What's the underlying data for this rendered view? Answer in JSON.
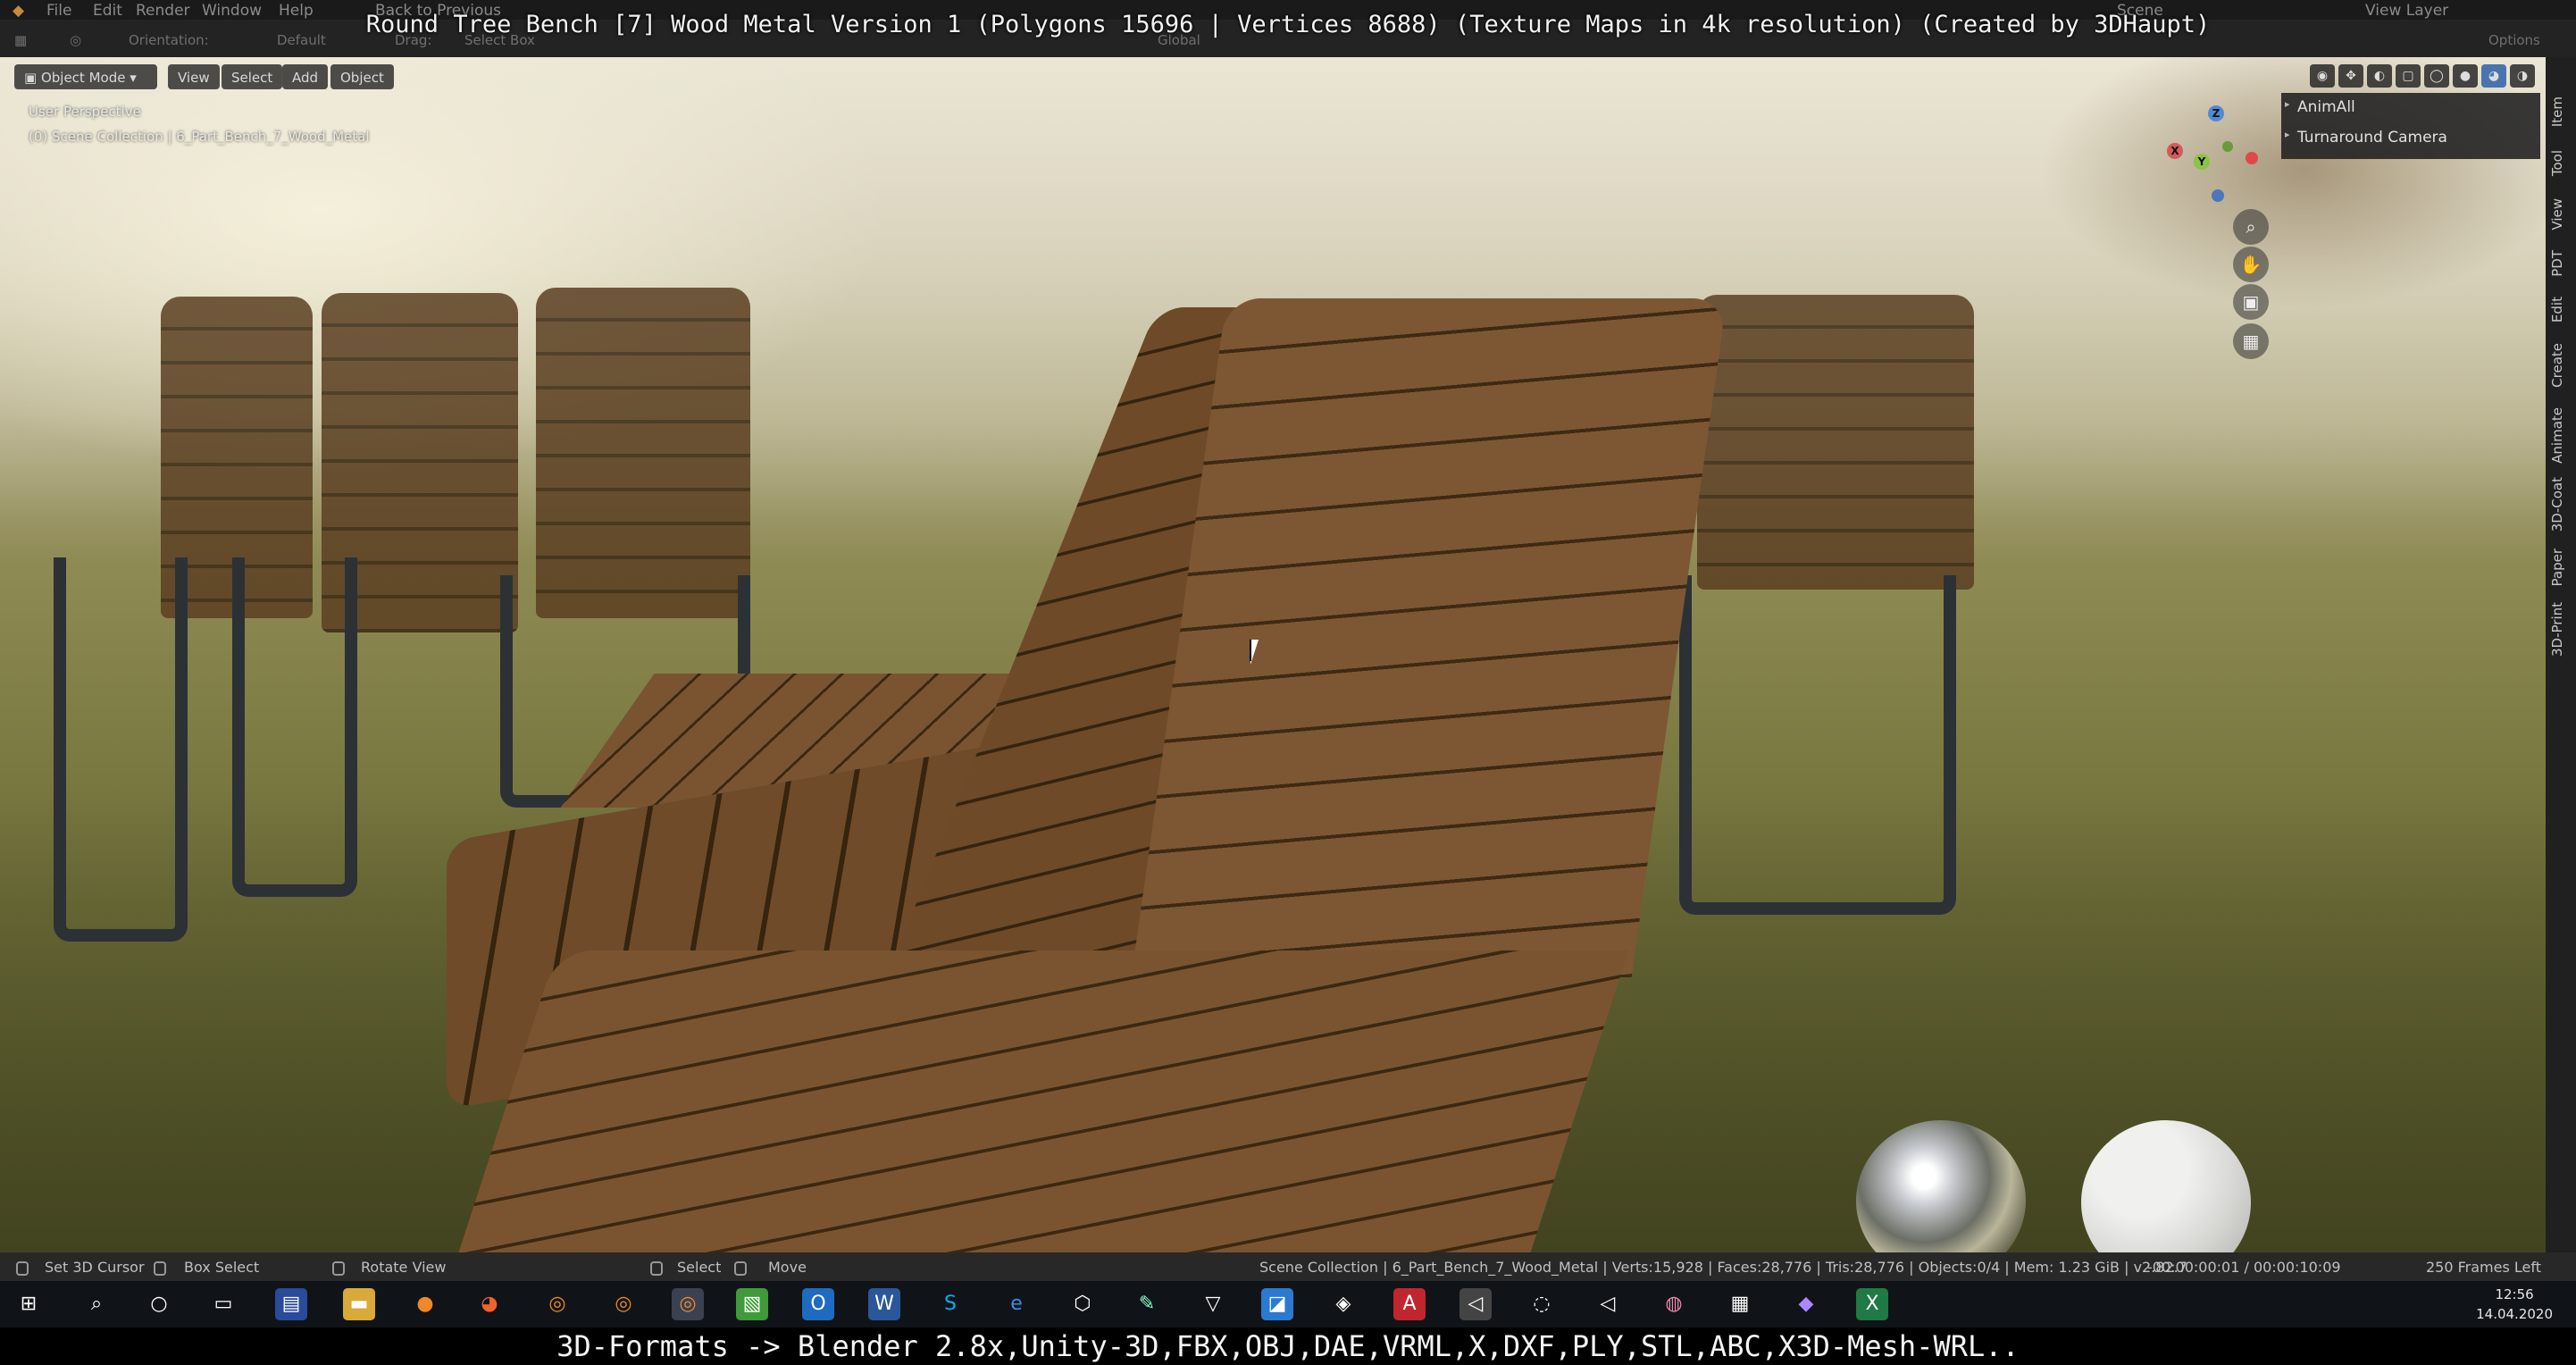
{
  "video_title": "Round Tree Bench [7] Wood Metal Version 1 (Polygons 15696 | Vertices 8688) (Texture Maps in 4k resolution) (Created by 3DHaupt)",
  "menubar": {
    "items": [
      "File",
      "Edit",
      "Render",
      "Window",
      "Help"
    ],
    "back_to_previous": "Back to Previous",
    "scene": "Scene",
    "view_layer": "View Layer"
  },
  "header": {
    "orientation_label": "Orientation:",
    "orientation_value": "Default",
    "drag_label": "Drag:",
    "drag_value": "Select Box",
    "transform_value": "Global",
    "options_label": "Options"
  },
  "viewport_header": {
    "mode": "Object Mode",
    "menus": [
      "View",
      "Select",
      "Add",
      "Object"
    ]
  },
  "viewport_info": {
    "perspective": "User Perspective",
    "collection": "(0) Scene Collection | 6_Part_Bench_7_Wood_Metal"
  },
  "gizmo": {
    "x": "X",
    "y": "Y",
    "z": "Z"
  },
  "side_panel": {
    "items": [
      "AnimAll",
      "Turnaround Camera"
    ],
    "tabs": [
      "Item",
      "Tool",
      "View",
      "PDT",
      "Edit",
      "Create",
      "Animate",
      "3D-Coat",
      "Paper",
      "3D-Print"
    ]
  },
  "statusbar": {
    "set_cursor": "Set 3D Cursor",
    "box_select": "Box Select",
    "rotate_view": "Rotate View",
    "select": "Select",
    "move": "Move",
    "stats": "Scene Collection | 6_Part_Bench_7_Wood_Metal | Verts:15,928 | Faces:28,776 | Tris:28,776 | Objects:0/4 | Mem: 1.23 GiB | v2.82.7",
    "timecode": "-00:00:00:01 / 00:00:10:09",
    "frames_left": "250 Frames Left"
  },
  "taskbar": {
    "icons": [
      "windows-icon",
      "search-icon",
      "cortana-icon",
      "task-view-icon",
      "save-app-icon",
      "file-explorer-icon",
      "blender-orange-icon",
      "firefox-icon",
      "blender-icon",
      "blender-icon",
      "blender-active-icon",
      "green-app-icon",
      "outlook-icon",
      "word-icon",
      "skype-icon",
      "edge-icon",
      "box-3d-icon",
      "sketch-icon",
      "vectary-icon",
      "app-icon",
      "substance-icon",
      "acrobat-icon",
      "unity-icon",
      "unity-hub-icon",
      "unity-icon",
      "paint-icon",
      "calculator-icon",
      "maps-icon",
      "excel-icon"
    ],
    "time": "12:56",
    "date": "14.04.2020"
  },
  "subtitle": "3D-Formats -> Blender 2.8x,Unity-3D,FBX,OBJ,DAE,VRML,X,DXF,PLY,STL,ABC,X3D-Mesh-WRL.."
}
